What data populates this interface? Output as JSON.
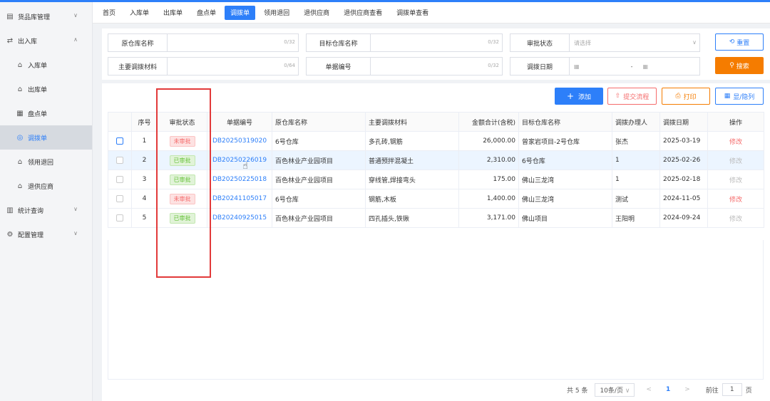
{
  "sidebar": {
    "items": [
      {
        "label": "货品库管理",
        "icon": "inventory-icon",
        "chevron": "∨"
      },
      {
        "label": "出入库",
        "icon": "inout-icon",
        "chevron": "∧"
      },
      {
        "label": "入库单",
        "icon": "home-icon"
      },
      {
        "label": "出库单",
        "icon": "home-icon"
      },
      {
        "label": "盘点单",
        "icon": "grid-icon"
      },
      {
        "label": "调拨单",
        "icon": "target-icon"
      },
      {
        "label": "领用退回",
        "icon": "home-icon"
      },
      {
        "label": "退供应商",
        "icon": "home-icon"
      },
      {
        "label": "统计查询",
        "icon": "chart-icon",
        "chevron": "∨"
      },
      {
        "label": "配置管理",
        "icon": "settings-icon",
        "chevron": "∨"
      }
    ]
  },
  "tabs": [
    "首页",
    "入库单",
    "出库单",
    "盘点单",
    "调拨单",
    "领用退回",
    "退供应商",
    "退供应商查看",
    "调拨单查看"
  ],
  "filters": {
    "source_wh": {
      "label": "原仓库名称",
      "count": "0/32"
    },
    "target_wh": {
      "label": "目标仓库名称",
      "count": "0/32"
    },
    "approval": {
      "label": "审批状态",
      "placeholder": "请选择"
    },
    "material": {
      "label": "主要调拨材料",
      "count": "0/64"
    },
    "doc_no": {
      "label": "单据编号",
      "count": "0/32"
    },
    "date": {
      "label": "调拨日期",
      "sep": "-"
    },
    "reset_label": "重置",
    "search_label": "搜索"
  },
  "toolbar": {
    "add_label": "添加",
    "submit_label": "提交流程",
    "print_label": "打印",
    "toggle_label": "显/隐列"
  },
  "table": {
    "headers": [
      "",
      "序号",
      "审批状态",
      "单据编号",
      "原仓库名称",
      "主要调拨材料",
      "金额合计(含税)",
      "目标仓库名称",
      "调拨办理人",
      "调拨日期",
      "操作"
    ],
    "rows": [
      {
        "no": "1",
        "status": "未审批",
        "doc": "DB20250319020",
        "src": "6号仓库",
        "mat": "多孔砖,钢筋",
        "amt": "26,000.00",
        "dst": "曾家岩项目-2号仓库",
        "person": "张杰",
        "date": "2025-03-19",
        "op": "修改"
      },
      {
        "no": "2",
        "status": "已审批",
        "doc": "DB20250226019",
        "src": "百色林业产业园项目",
        "mat": "普通预拌混凝土",
        "amt": "2,310.00",
        "dst": "6号仓库",
        "person": "1",
        "date": "2025-02-26",
        "op": "修改"
      },
      {
        "no": "3",
        "status": "已审批",
        "doc": "DB20250225018",
        "src": "百色林业产业园项目",
        "mat": "穿线管,焊接弯头",
        "amt": "175.00",
        "dst": "佛山三龙湾",
        "person": "1",
        "date": "2025-02-18",
        "op": "修改"
      },
      {
        "no": "4",
        "status": "未审批",
        "doc": "DB20241105017",
        "src": "6号仓库",
        "mat": "钢筋,木板",
        "amt": "1,400.00",
        "dst": "佛山三龙湾",
        "person": "测试",
        "date": "2024-11-05",
        "op": "修改"
      },
      {
        "no": "5",
        "status": "已审批",
        "doc": "DB20240925015",
        "src": "百色林业产业园项目",
        "mat": "四孔插头,铁锹",
        "amt": "3,171.00",
        "dst": "佛山项目",
        "person": "王阳明",
        "date": "2024-09-24",
        "op": "修改"
      }
    ]
  },
  "pager": {
    "total": "共 5 条",
    "size": "10条/页",
    "prev": "<",
    "page": "1",
    "next": ">",
    "goto": "前往",
    "goto_value": "1",
    "suffix": "页"
  },
  "colors": {
    "accent": "#2d7ff9",
    "search": "#f57c00",
    "danger": "#f56c6c",
    "success": "#67c23a"
  }
}
